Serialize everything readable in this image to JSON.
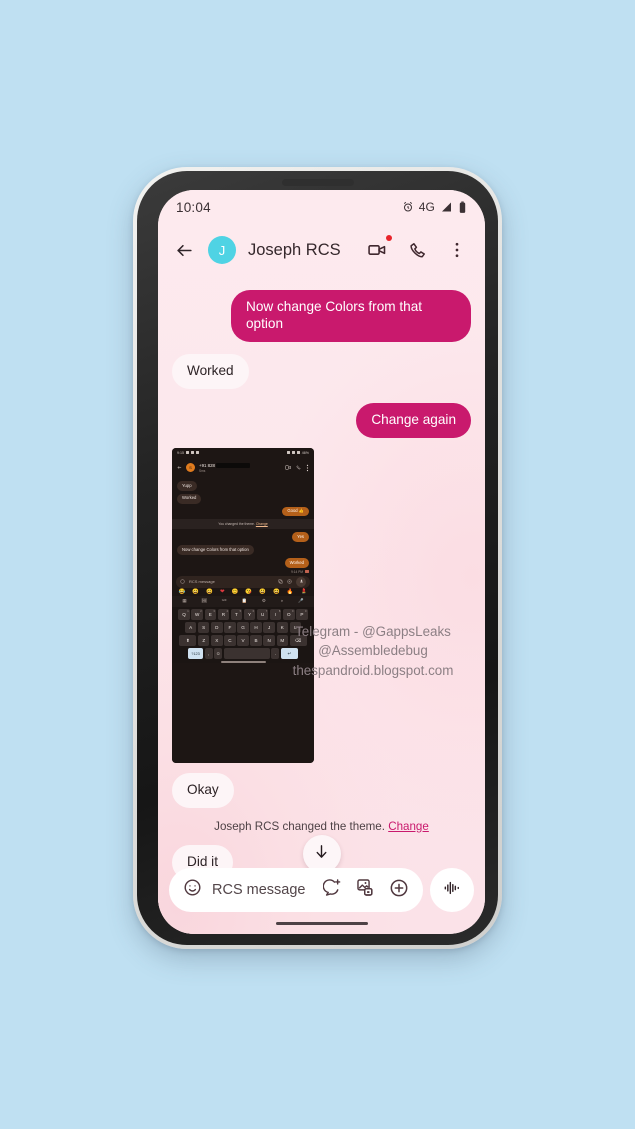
{
  "app": {
    "name": "Google Messages RCS chat"
  },
  "status_bar": {
    "time": "10:04",
    "alarm_icon": "alarm-clock-icon",
    "network": "4G",
    "signal_icon": "signal-bars-icon",
    "battery_icon": "battery-full-icon"
  },
  "app_bar": {
    "back_icon": "back-arrow-icon",
    "avatar_initial": "J",
    "avatar_color": "#4fd3e4",
    "contact_name": "Joseph RCS",
    "video_call_icon": "video-camera-icon",
    "video_badge": "red-dot-badge",
    "voice_call_icon": "phone-handset-icon",
    "overflow_icon": "three-dot-menu-icon"
  },
  "theme": {
    "sent_bubble_color": "#c9196d",
    "received_bubble_color": "#fdf5f7",
    "background_color": "#fce9ec",
    "link_color": "#c9196d"
  },
  "messages": [
    {
      "id": 1,
      "side": "out",
      "text": "Now change Colors from that option"
    },
    {
      "id": 2,
      "side": "in",
      "text": "Worked"
    },
    {
      "id": 3,
      "side": "out",
      "text": "Change again"
    },
    {
      "id": 4,
      "side": "in",
      "type": "image",
      "alt": "screenshot-attachment"
    },
    {
      "id": 5,
      "side": "in",
      "text": "Okay"
    },
    {
      "id": 6,
      "side": "in",
      "text": "Did it"
    }
  ],
  "system_event": {
    "text": "Joseph RCS changed the theme.",
    "action_label": "Change"
  },
  "scroll_fab": {
    "icon": "arrow-down-icon"
  },
  "composer": {
    "emoji_icon": "emoji-smiley-icon",
    "placeholder": "RCS message",
    "sticker_icon": "sticker-add-icon",
    "gallery_icon": "gallery-image-icon",
    "plus_icon": "plus-circle-icon",
    "mic_icon": "voice-waveform-icon"
  },
  "watermark": {
    "line1": "Telegram - @GappsLeaks",
    "line2": "@Assembledebug",
    "line3": "thespandroid.blogspot.com"
  },
  "attachment_screenshot": {
    "status_time": "9:15",
    "battery": "46%",
    "avatar_initial": "S",
    "contact_name": "+91 828",
    "contact_sub": "Sms",
    "messages": [
      {
        "side": "in",
        "text": "Yupp"
      },
      {
        "side": "in",
        "text": "Worked"
      },
      {
        "side": "out",
        "text": "Good 👍"
      },
      {
        "side": "system",
        "text": "You changed the theme.",
        "action": "Change"
      },
      {
        "side": "out",
        "text": "Yes"
      },
      {
        "side": "in",
        "text": "Now change Colors from that option"
      },
      {
        "side": "out",
        "text": "Worked"
      }
    ],
    "timestamp": "9:14 PM",
    "composer_placeholder": "RCS message",
    "keyboard": {
      "row1": [
        "Q",
        "W",
        "E",
        "R",
        "T",
        "Y",
        "U",
        "I",
        "O",
        "P"
      ],
      "row1_sup": [
        "1",
        "2",
        "3",
        "4",
        "5",
        "6",
        "7",
        "8",
        "9",
        "0"
      ],
      "row2": [
        "A",
        "S",
        "D",
        "F",
        "G",
        "H",
        "J",
        "K",
        "L"
      ],
      "row3": [
        "Z",
        "X",
        "C",
        "V",
        "B",
        "N",
        "M"
      ],
      "shift_key": "⬆",
      "backspace_key": "⌫",
      "symbols_key": "?123",
      "comma_key": ",",
      "emoji_key": "☺",
      "period_key": ".",
      "enter_key": "↵"
    },
    "emoji_row": [
      "😂",
      "😀",
      "😄",
      "❤",
      "😊",
      "😘",
      "😃",
      "😆",
      "🔥",
      "💄"
    ]
  }
}
